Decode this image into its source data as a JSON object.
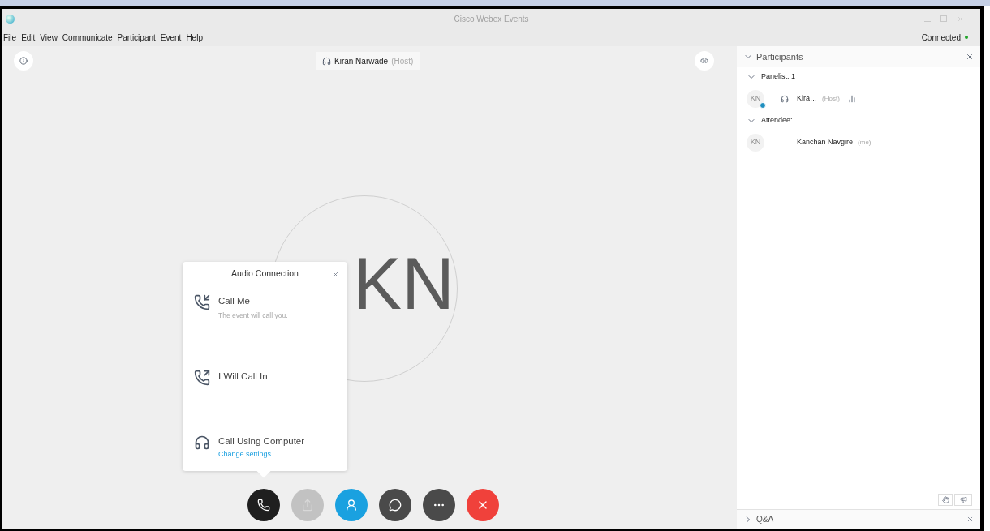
{
  "window": {
    "title": "Cisco Webex Events"
  },
  "menu": [
    "File",
    "Edit",
    "View",
    "Communicate",
    "Participant",
    "Event",
    "Help"
  ],
  "status": {
    "label": "Connected",
    "color": "#22a52a"
  },
  "stage": {
    "host_name": "Kiran Narwade",
    "host_role": "(Host)",
    "avatar_initials": "KN"
  },
  "audio_dialog": {
    "title": "Audio Connection",
    "options": [
      {
        "kind": "call_me",
        "label": "Call Me",
        "description": "The event will call you."
      },
      {
        "kind": "call_in",
        "label": "I Will Call In"
      },
      {
        "kind": "computer",
        "label": "Call Using Computer",
        "link": "Change settings"
      }
    ]
  },
  "controls": [
    {
      "kind": "phone",
      "disabled": false
    },
    {
      "kind": "share",
      "disabled": true
    },
    {
      "kind": "participants",
      "disabled": false
    },
    {
      "kind": "chat",
      "disabled": false
    },
    {
      "kind": "more",
      "disabled": false
    },
    {
      "kind": "leave",
      "disabled": false
    }
  ],
  "participants": {
    "title": "Participants",
    "expanded": true,
    "groups": [
      {
        "label": "Panelist: 1",
        "expanded": true,
        "members": [
          {
            "initials": "KN",
            "name": "Kira…",
            "role": "(Host)",
            "host": true
          }
        ]
      },
      {
        "label": "Attendee:",
        "expanded": true,
        "members": [
          {
            "initials": "KN",
            "name": "Kanchan Navgire",
            "role": "(me)",
            "host": false
          }
        ]
      }
    ]
  },
  "qa": {
    "title": "Q&A",
    "expanded": false
  }
}
